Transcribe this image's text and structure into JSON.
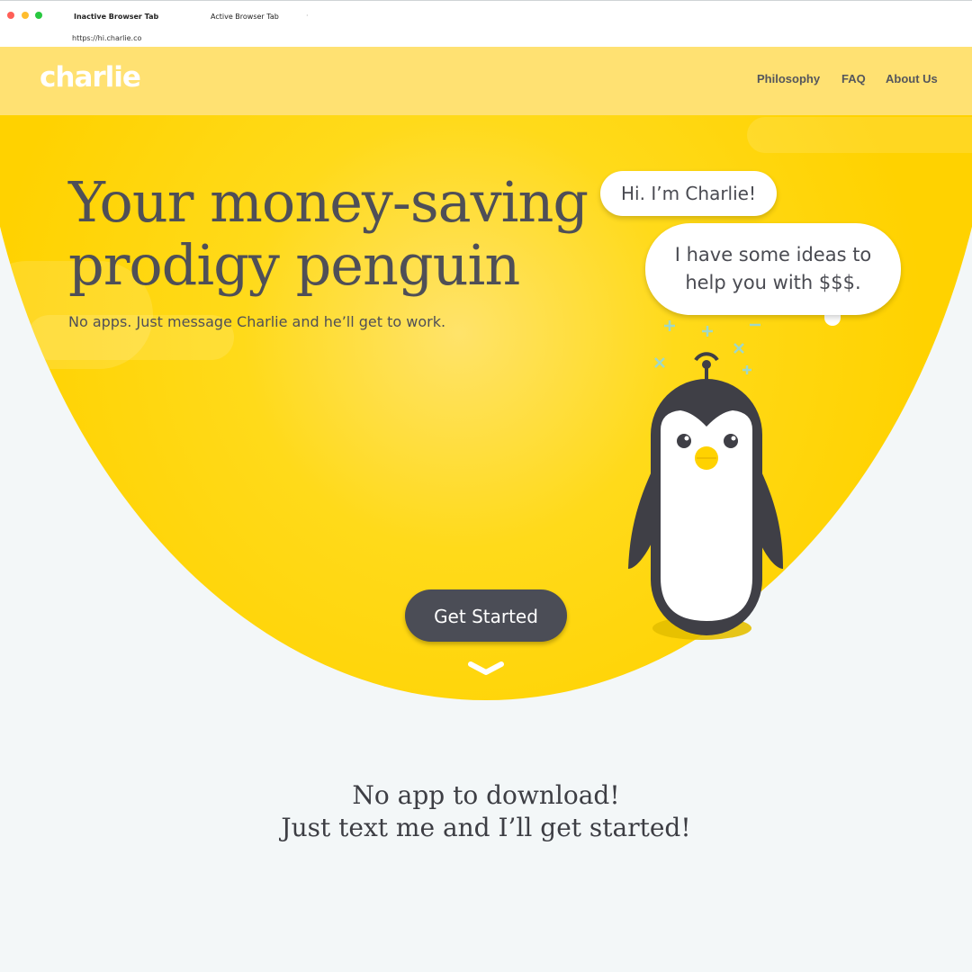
{
  "browser": {
    "tabs": [
      {
        "label": "Inactive Browser Tab"
      },
      {
        "label": "Active Browser Tab"
      }
    ],
    "url": "https://hi.charlie.co"
  },
  "site": {
    "logo": "charlie",
    "nav": [
      {
        "label": "Philosophy"
      },
      {
        "label": "FAQ"
      },
      {
        "label": "About Us"
      }
    ]
  },
  "hero": {
    "headline_line1": "Your money-saving",
    "headline_line2": "prodigy penguin",
    "subheadline": "No apps. Just message Charlie and he’ll get to work.",
    "bubble1": "Hi. I’m Charlie!",
    "bubble2_line1": "I have some ideas to",
    "bubble2_line2": "help you with $$$.",
    "cta_label": "Get Started"
  },
  "section2": {
    "line1": "No app to download!",
    "line2": "Just text me and I’ll get started!"
  },
  "colors": {
    "brand_yellow": "#ffd200",
    "header_yellow": "#ffe172",
    "dark_gray": "#4b4d56",
    "background": "#f3f7f8"
  },
  "icons": [
    "close-red-dot",
    "minimize-yellow-dot",
    "maximize-green-dot",
    "penguin-illustration",
    "chevron-down-icon"
  ]
}
